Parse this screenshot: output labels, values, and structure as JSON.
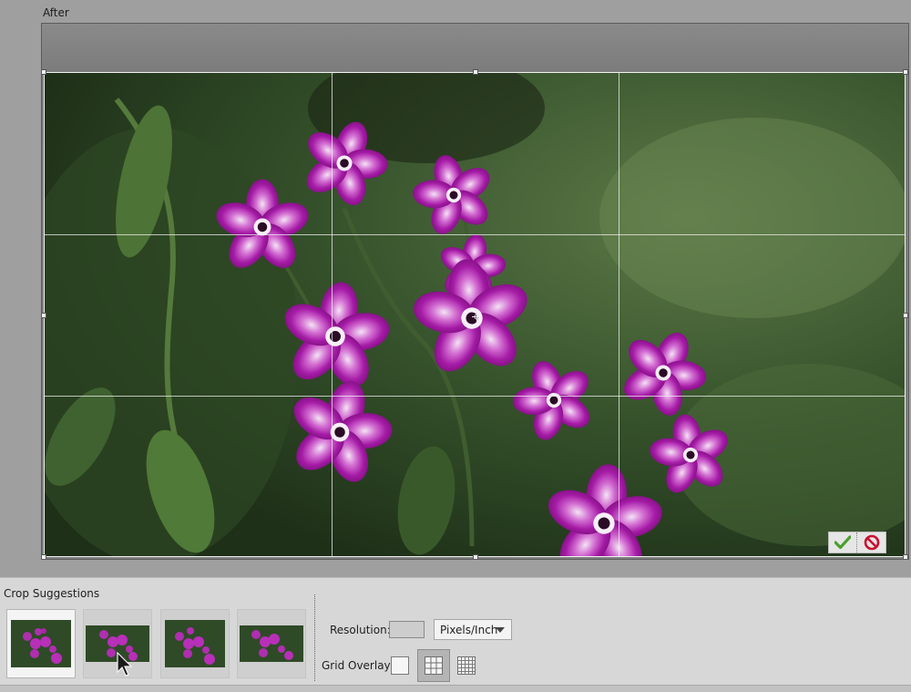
{
  "view": {
    "label": "After"
  },
  "crop_actions": {
    "commit_icon": "checkmark-icon",
    "cancel_icon": "no-entry-icon",
    "commit_color": "#4aa02c",
    "cancel_color": "#c8102e"
  },
  "panel": {
    "title": "Crop Suggestions",
    "suggestions": [
      {
        "name": "suggestion-1",
        "selected": true
      },
      {
        "name": "suggestion-2",
        "selected": false
      },
      {
        "name": "suggestion-3",
        "selected": false
      },
      {
        "name": "suggestion-4",
        "selected": false
      }
    ],
    "resolution_label": "Resolution:",
    "resolution_value": "",
    "unit_value": "Pixels/Inch",
    "grid_overlay_label": "Grid Overlay:",
    "grid_options": [
      {
        "name": "grid-none",
        "icon": "blank-square-icon",
        "active": false
      },
      {
        "name": "grid-thirds",
        "icon": "rule-of-thirds-grid-icon",
        "active": true
      },
      {
        "name": "grid-fine",
        "icon": "fine-grid-icon",
        "active": false
      }
    ]
  },
  "colors": {
    "flower": "#9a1497",
    "flower_light": "#e8c6ef",
    "foliage": "#3c5d2c"
  }
}
